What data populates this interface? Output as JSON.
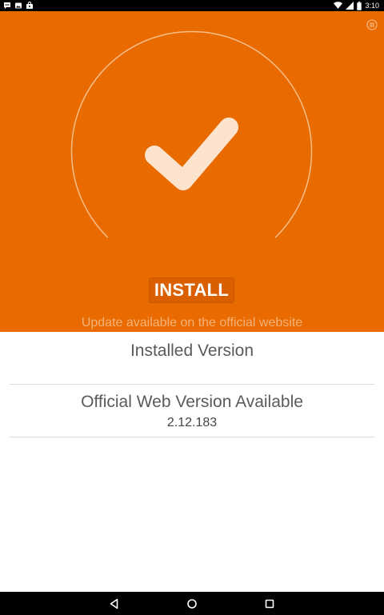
{
  "status_bar": {
    "time": "3:10",
    "left_icons": [
      "chat-bubble-icon",
      "gallery-icon",
      "shopping-bag-icon"
    ],
    "right_icons": [
      "wifi-icon",
      "cellular-signal-icon",
      "battery-icon"
    ]
  },
  "hero": {
    "background_color": "#E96B00",
    "menu_icon": "menu-icon",
    "status_icon": "checkmark-icon",
    "install_label": "INSTALL",
    "update_notice": "Update available on the official website"
  },
  "versions": {
    "installed_label": "Installed Version",
    "installed_value": "",
    "web_label": "Official Web Version Available",
    "web_value": "2.12.183"
  },
  "nav_bar": {
    "buttons": [
      "back-icon",
      "home-icon",
      "recents-icon"
    ]
  }
}
